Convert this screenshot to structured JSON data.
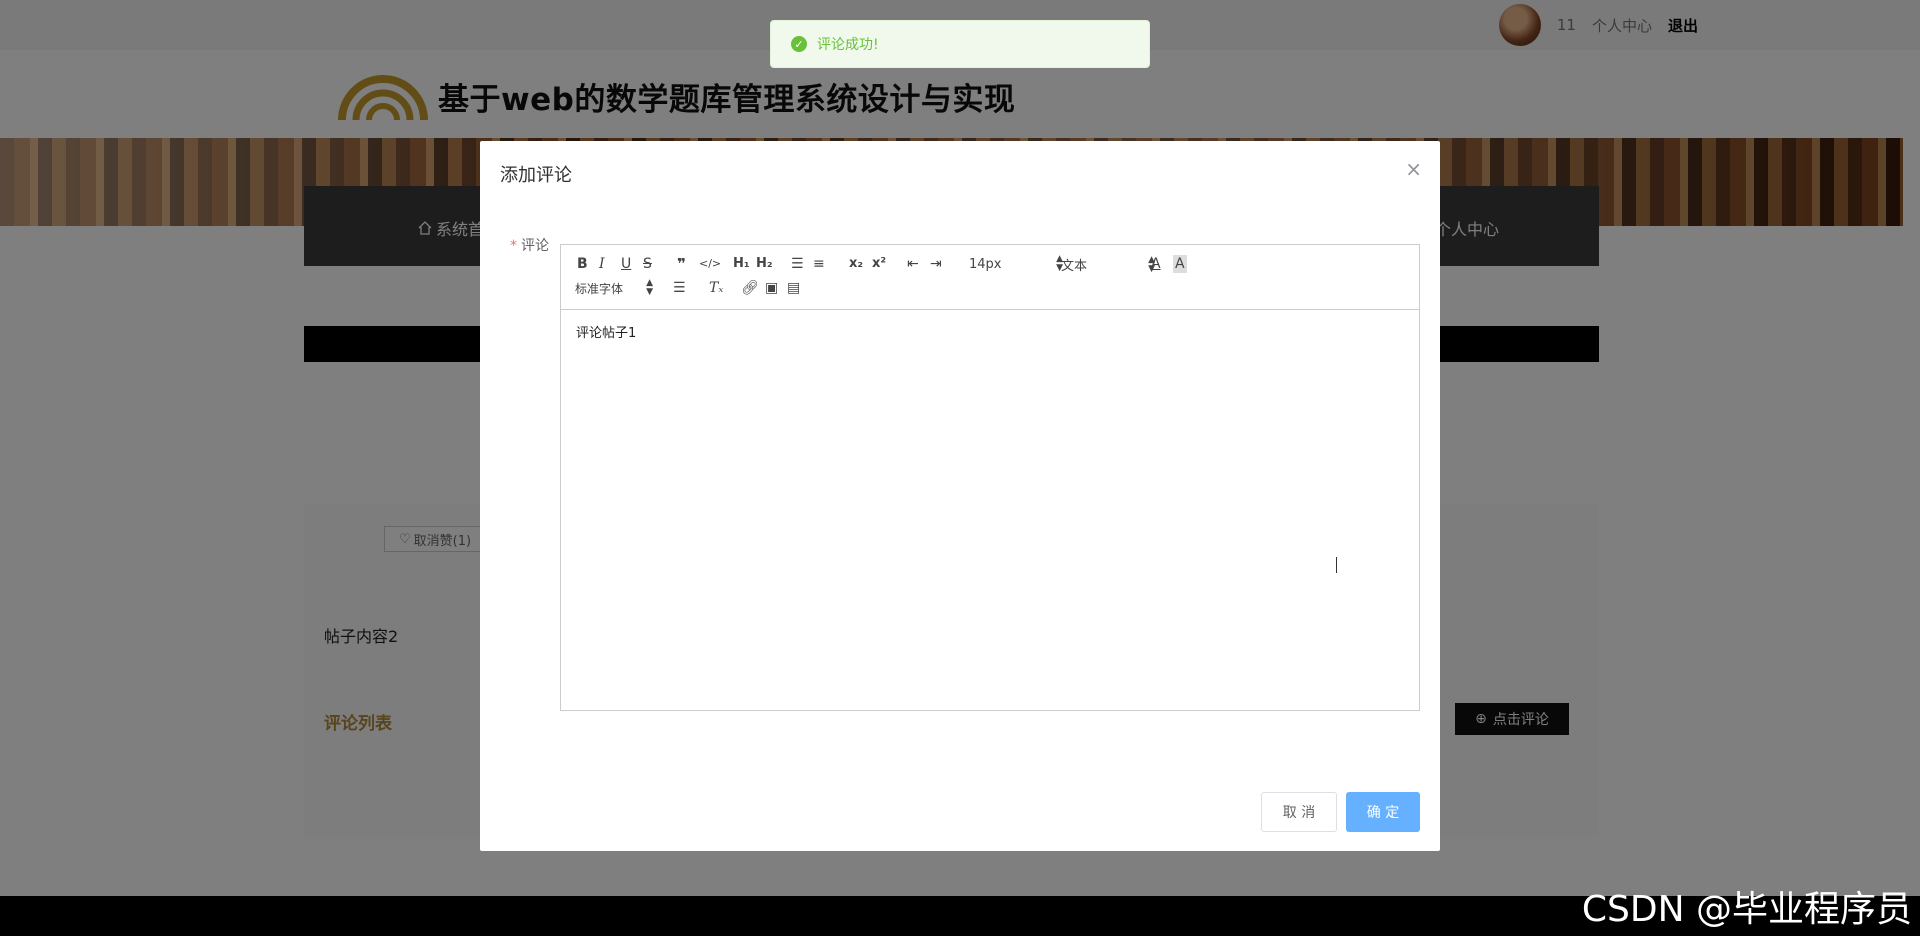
{
  "topbar": {
    "username": "11",
    "personal_center": "个人中心",
    "logout": "退出"
  },
  "header": {
    "site_title": "基于web的数学题库管理系统设计与实现"
  },
  "nav": {
    "home": "系统首",
    "personal_center": "个人中心"
  },
  "post": {
    "unlike_label": "取消赞(1)",
    "content": "帖子内容2",
    "comment_list_title": "评论列表",
    "click_comment_label": "点击评论"
  },
  "toast": {
    "message": "评论成功!",
    "type": "success"
  },
  "dialog": {
    "title": "添加评论",
    "field_label": "评论",
    "required_mark": "*",
    "editor_content": "评论帖子1",
    "toolbar": {
      "font_size": "14px",
      "heading": "文本",
      "font_family": "标准字体"
    },
    "cancel_label": "取 消",
    "confirm_label": "确 定"
  },
  "watermark": "CSDN @毕业程序员",
  "colors": {
    "success": "#67c23a",
    "primary_button": "#66b1ff",
    "accent_gold": "#b08a3c"
  }
}
